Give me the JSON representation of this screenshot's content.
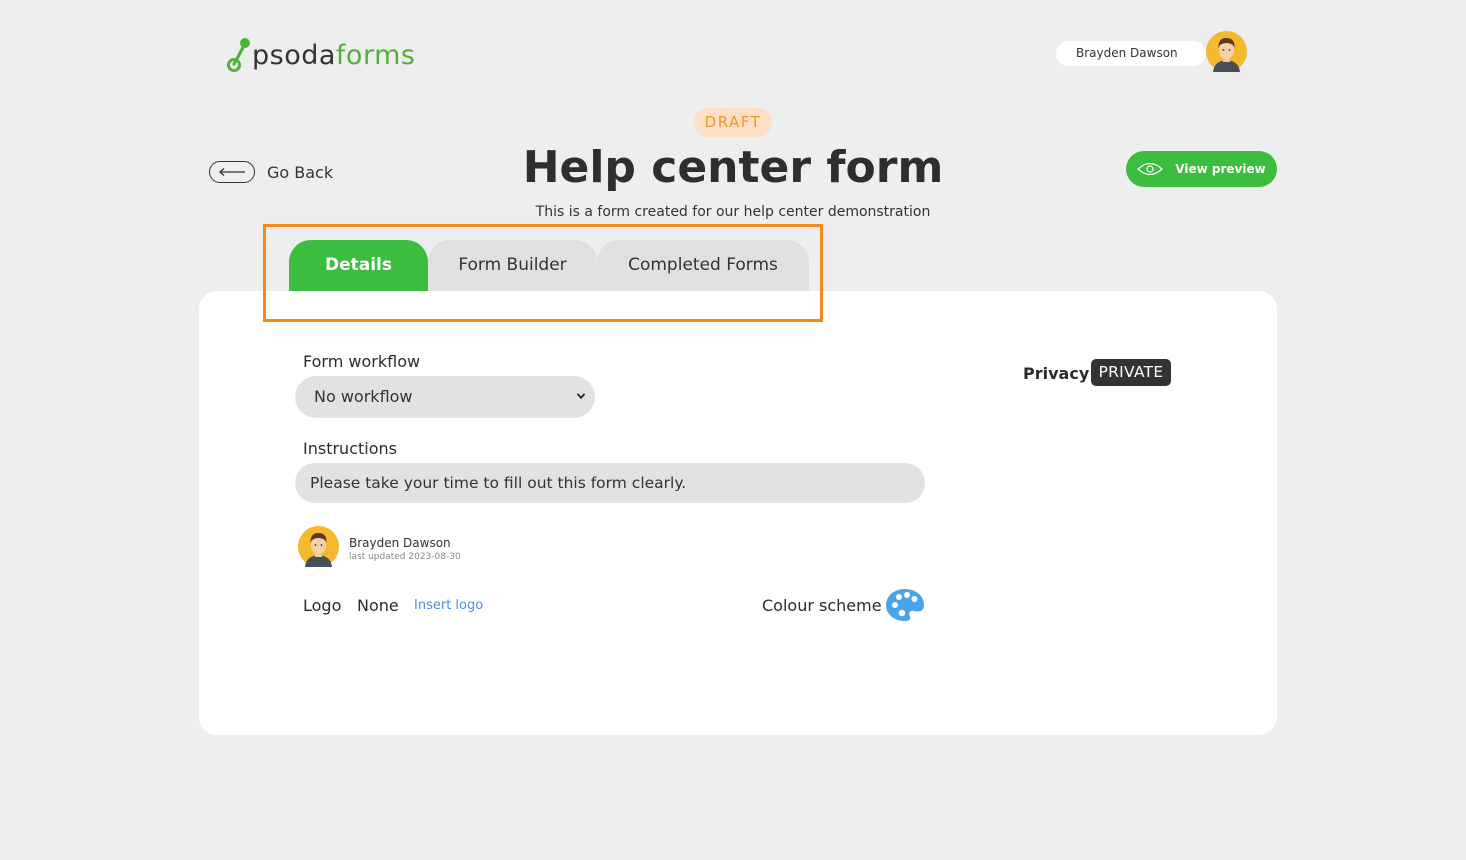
{
  "brand": {
    "logo_text_dark": "psoda",
    "logo_text_green": "forms",
    "accent": "#3cbd3f",
    "logo_green": "#52b03c"
  },
  "user": {
    "name": "Brayden Dawson",
    "avatar_icon": "user-avatar-icon"
  },
  "header": {
    "status_badge": "DRAFT",
    "title": "Help center form",
    "subtitle": "This is a form created for our help center demonstration",
    "go_back_label": "Go Back",
    "view_preview_label": "View preview"
  },
  "tabs": [
    {
      "label": "Details",
      "active": true
    },
    {
      "label": "Form Builder",
      "active": false
    },
    {
      "label": "Completed Forms",
      "active": false
    }
  ],
  "details": {
    "workflow_label": "Form workflow",
    "workflow_value": "No workflow",
    "instructions_label": "Instructions",
    "instructions_value": "Please take your time to fill out this form clearly.",
    "author_name": "Brayden Dawson",
    "last_updated": "last updated 2023-08-30",
    "logo_label": "Logo",
    "logo_value": "None",
    "insert_logo_label": "Insert logo",
    "colour_scheme_label": "Colour scheme",
    "privacy_label": "Privacy",
    "privacy_value": "PRIVATE"
  },
  "highlight_color": "#f5891e"
}
